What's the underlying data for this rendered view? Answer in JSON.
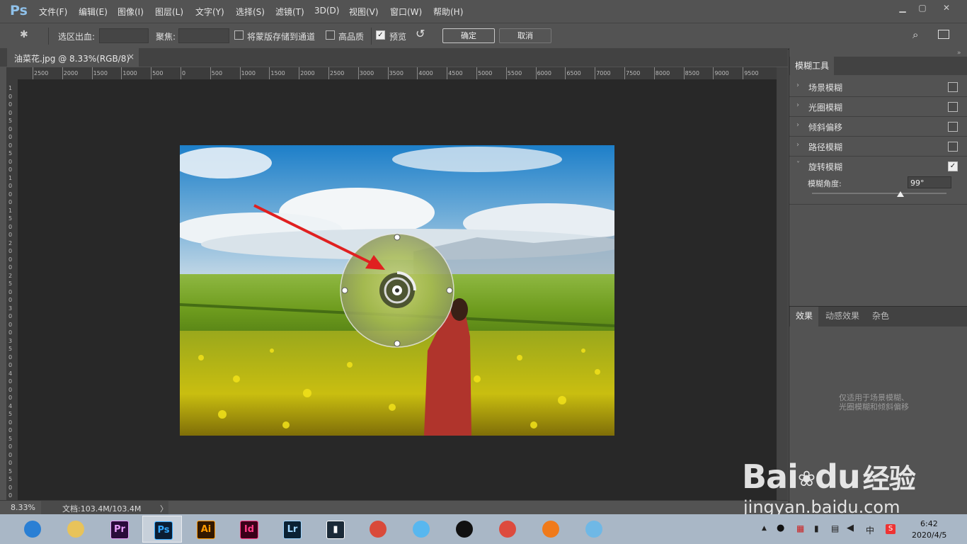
{
  "app": {
    "logo": "Ps"
  },
  "menu": [
    "文件(F)",
    "编辑(E)",
    "图像(I)",
    "图层(L)",
    "文字(Y)",
    "选择(S)",
    "滤镜(T)",
    "3D(D)",
    "视图(V)",
    "窗口(W)",
    "帮助(H)"
  ],
  "options": {
    "selection_bleed_label": "选区出血:",
    "focus_label": "聚焦:",
    "save_mask_label": "将蒙版存储到通道",
    "high_quality_label": "高品质",
    "preview_label": "预览",
    "preview_checked": true,
    "ok_label": "确定",
    "cancel_label": "取消"
  },
  "document": {
    "tab_title": "油菜花.jpg @ 8.33%(RGB/8)",
    "close": "×"
  },
  "ruler_h": [
    "2500",
    "2000",
    "1500",
    "1000",
    "500",
    "0",
    "500",
    "1000",
    "1500",
    "2000",
    "2500",
    "3000",
    "3500",
    "4000",
    "4500",
    "5000",
    "5500",
    "6000",
    "6500",
    "7000",
    "7500",
    "8000",
    "8500",
    "9000",
    "9500"
  ],
  "ruler_v": [
    "1",
    "0",
    "0",
    "0",
    "5",
    "0",
    "0",
    "0",
    "5",
    "0",
    "0",
    "1",
    "0",
    "0",
    "0",
    "1",
    "5",
    "0",
    "0",
    "2",
    "0",
    "0",
    "0",
    "2",
    "5",
    "0",
    "0",
    "3",
    "0",
    "0",
    "0",
    "3",
    "5",
    "0",
    "0",
    "4",
    "0",
    "0",
    "0",
    "4",
    "5",
    "0",
    "0",
    "5",
    "0",
    "0",
    "0",
    "5",
    "5",
    "0",
    "0"
  ],
  "status": {
    "zoom": "8.33%",
    "doc": "文档:103.4M/103.4M",
    "arrow": "〉"
  },
  "blur_panel": {
    "tab": "模糊工具",
    "items": [
      {
        "label": "场景模糊",
        "checked": false,
        "expanded": false
      },
      {
        "label": "光圈模糊",
        "checked": false,
        "expanded": false
      },
      {
        "label": "倾斜偏移",
        "checked": false,
        "expanded": false
      },
      {
        "label": "路径模糊",
        "checked": false,
        "expanded": false
      },
      {
        "label": "旋转模糊",
        "checked": true,
        "expanded": true
      }
    ],
    "angle_label": "模糊角度:",
    "angle_value": "99°",
    "angle_fraction": 0.66
  },
  "effects_panel": {
    "tabs": [
      "效果",
      "动感效果",
      "杂色"
    ],
    "note_line1": "仅适用于场景模糊、",
    "note_line2": "光圈模糊和倾斜偏移"
  },
  "watermark": {
    "brand": "Bai",
    "brand2": "du",
    "cn": "经验",
    "url": "jingyan.baidu.com"
  },
  "taskbar": {
    "apps": [
      {
        "name": "browser-icon",
        "text": "",
        "color": "#2a7fd4"
      },
      {
        "name": "explorer-icon",
        "text": "",
        "color": "#e8c35a"
      },
      {
        "name": "premiere-icon",
        "text": "Pr",
        "color": "#2a0b3a",
        "fg": "#e69cf7"
      },
      {
        "name": "photoshop-icon",
        "text": "Ps",
        "color": "#0b1d33",
        "fg": "#31a8ff",
        "active": true
      },
      {
        "name": "illustrator-icon",
        "text": "Ai",
        "color": "#321800",
        "fg": "#ff9a00"
      },
      {
        "name": "indesign-icon",
        "text": "Id",
        "color": "#3a0019",
        "fg": "#ff3b86"
      },
      {
        "name": "lightroom-icon",
        "text": "Lr",
        "color": "#0a2133",
        "fg": "#9fd6ff"
      },
      {
        "name": "video-editor-icon",
        "text": "▮",
        "color": "#1b2a38",
        "fg": "#ffffff"
      },
      {
        "name": "umbrella-app-icon",
        "text": "",
        "color": "#d94a3a"
      },
      {
        "name": "chat-app-icon",
        "text": "",
        "color": "#58b7ef"
      },
      {
        "name": "qq-icon",
        "text": "",
        "color": "#111111"
      },
      {
        "name": "chrome-icon",
        "text": "",
        "color": "#dd4b3e"
      },
      {
        "name": "fox-app-icon",
        "text": "",
        "color": "#f07a1a"
      },
      {
        "name": "notebook-icon",
        "text": "",
        "color": "#6fb8e6"
      }
    ],
    "tray_ime": "中",
    "time": "6:42",
    "date": "2020/4/5"
  }
}
